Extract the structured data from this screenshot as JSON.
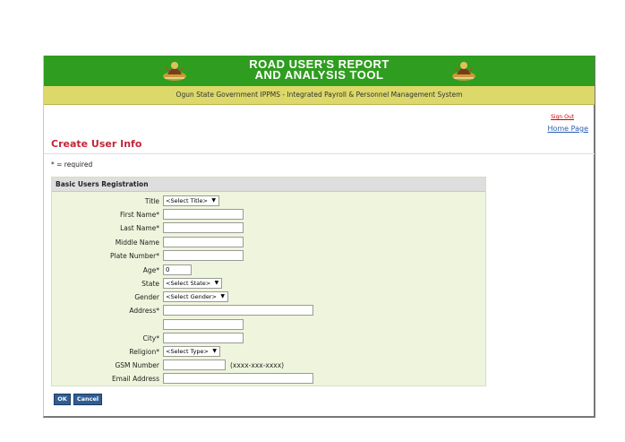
{
  "banner": {
    "title_line1": "ROAD USER'S REPORT",
    "title_line2": "AND ANALYSIS TOOL",
    "bg_color": "#2f9d1f"
  },
  "subbar": {
    "text": "Ogun State Government IPPMS - Integrated Payroll & Personnel Management System"
  },
  "links": {
    "sign_out": "Sign Out",
    "home_page": "Home Page"
  },
  "page": {
    "title": "Create User Info",
    "required_note": "* = required"
  },
  "form": {
    "section_title": "Basic Users Registration",
    "title_label": "Title",
    "title_value": "<Select Title>",
    "first_name_label": "First Name*",
    "last_name_label": "Last Name*",
    "middle_name_label": "Middle Name",
    "plate_number_label": "Plate Number*",
    "age_label": "Age*",
    "age_value": "0",
    "state_label": "State",
    "state_value": "<Select State>",
    "gender_label": "Gender",
    "gender_value": "<Select Gender>",
    "address_label": "Address*",
    "city_label": "City*",
    "religion_label": "Religion*",
    "religion_value": "<Select Type>",
    "gsm_label": "GSM Number",
    "gsm_hint": "(xxxx-xxx-xxxx)",
    "email_label": "Email Address"
  },
  "buttons": {
    "ok": "OK",
    "cancel": "Cancel"
  },
  "icons": [
    "crest-icon-left",
    "crest-icon-right",
    "chevron-down-icon"
  ]
}
